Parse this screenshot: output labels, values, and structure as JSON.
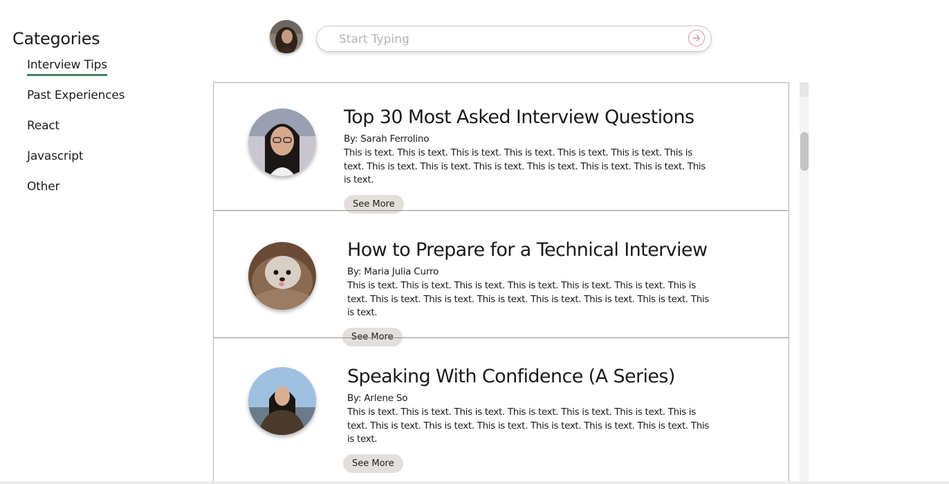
{
  "sidebar": {
    "title": "Categories",
    "items": [
      {
        "label": "Interview Tips",
        "active": true
      },
      {
        "label": "Past Experiences",
        "active": false
      },
      {
        "label": "React",
        "active": false
      },
      {
        "label": "Javascript",
        "active": false
      },
      {
        "label": "Other",
        "active": false
      }
    ]
  },
  "search": {
    "placeholder": "Start Typing",
    "value": "",
    "submit_icon": "arrow-right-circle-icon"
  },
  "colors": {
    "accent": "#3e8163",
    "button_bg": "#e3e0db",
    "search_icon": "#d99a9a"
  },
  "posts": [
    {
      "title": "Top 30 Most Asked Interview Questions",
      "author": "By: Sarah Ferrolino",
      "text": "This is text. This is text. This is text. This is text. This is text. This is text. This is text. This is text. This is text. This is text. This is text. This is text. This is text. This is text.",
      "button": "See More"
    },
    {
      "title": "How to Prepare for a Technical Interview",
      "author": "By: Maria Julia Curro",
      "text": "This is text. This is text. This is text. This is text. This is text. This is text. This is text. This is text. This is text. This is text. This is text. This is text. This is text. This is text.",
      "button": "See More"
    },
    {
      "title": "Speaking With Confidence (A Series)",
      "author": "By: Arlene So",
      "text": "This is text. This is text. This is text. This is text. This is text. This is text. This is text. This is text. This is text. This is text. This is text. This is text. This is text. This is text.",
      "button": "See More"
    }
  ]
}
